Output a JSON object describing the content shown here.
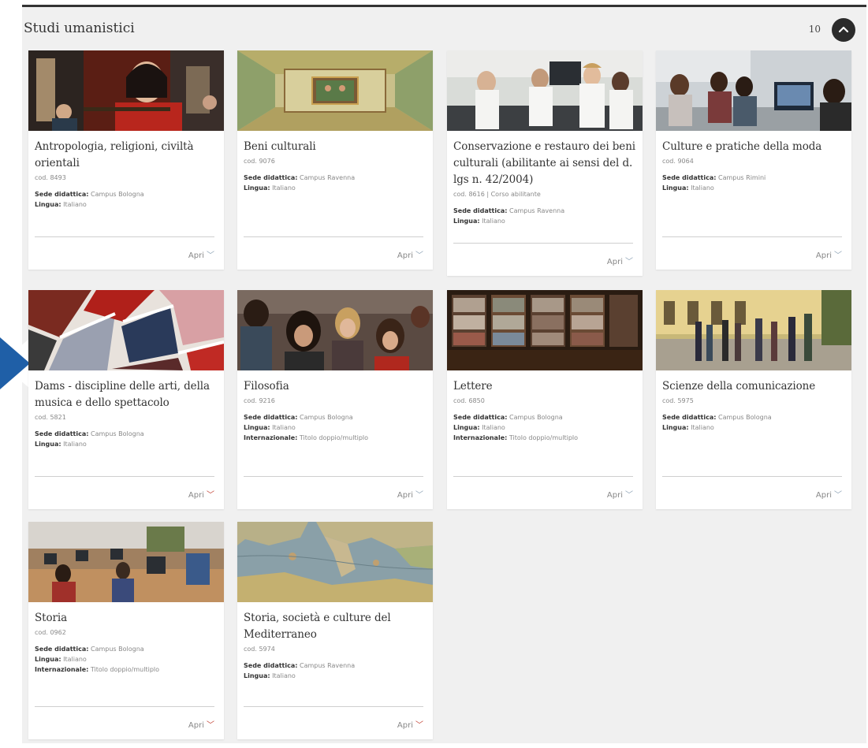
{
  "section": {
    "title": "Studi umanistici",
    "count": "10",
    "colors": {
      "header_line": "#333333",
      "panel_bg": "#f0f0f0",
      "arrow_blue": "#1f5fa7"
    }
  },
  "labels": {
    "campus": "Sede didattica:",
    "language": "Lingua:",
    "international": "Internazionale:",
    "open": "Apri"
  },
  "cards": [
    {
      "title": "Antropologia, religioni, civiltà orientali",
      "code": "cod. 8493",
      "campus": "Campus Bologna",
      "language": "Italiano",
      "international": "",
      "image": "photo-musician"
    },
    {
      "title": "Beni culturali",
      "code": "cod. 9076",
      "campus": "Campus Ravenna",
      "language": "Italiano",
      "international": "",
      "image": "photo-fresco-ceiling"
    },
    {
      "title": "Conservazione e restauro dei beni culturali (abilitante ai sensi del d. lgs n. 42/2004)",
      "code": "cod. 8616 | Corso abilitante",
      "campus": "Campus Ravenna",
      "language": "Italiano",
      "international": "",
      "image": "photo-laboratory"
    },
    {
      "title": "Culture e pratiche della moda",
      "code": "cod. 9064",
      "campus": "Campus Rimini",
      "language": "Italiano",
      "international": "",
      "image": "photo-students-monitor"
    },
    {
      "title": "Dams - discipline delle arti, della musica e dello spettacolo",
      "code": "cod. 5821",
      "campus": "Campus Bologna",
      "language": "Italiano",
      "international": "",
      "image": "photo-collage-arts"
    },
    {
      "title": "Filosofia",
      "code": "cod. 9216",
      "campus": "Campus Bologna",
      "language": "Italiano",
      "international": "Titolo doppio/multiplo",
      "image": "photo-lecture-students"
    },
    {
      "title": "Lettere",
      "code": "cod. 6850",
      "campus": "Campus Bologna",
      "language": "Italiano",
      "international": "Titolo doppio/multiplo",
      "image": "photo-library-shelves"
    },
    {
      "title": "Scienze della comunicazione",
      "code": "cod. 5975",
      "campus": "Campus Bologna",
      "language": "Italiano",
      "international": "",
      "image": "photo-courtyard-group"
    },
    {
      "title": "Storia",
      "code": "cod. 0962",
      "campus": "Campus Bologna",
      "language": "Italiano",
      "international": "Titolo doppio/multiplo",
      "image": "photo-computer-room"
    },
    {
      "title": "Storia, società e culture del Mediterraneo",
      "code": "cod. 5974",
      "campus": "Campus Ravenna",
      "language": "Italiano",
      "international": "",
      "image": "photo-old-map"
    }
  ]
}
